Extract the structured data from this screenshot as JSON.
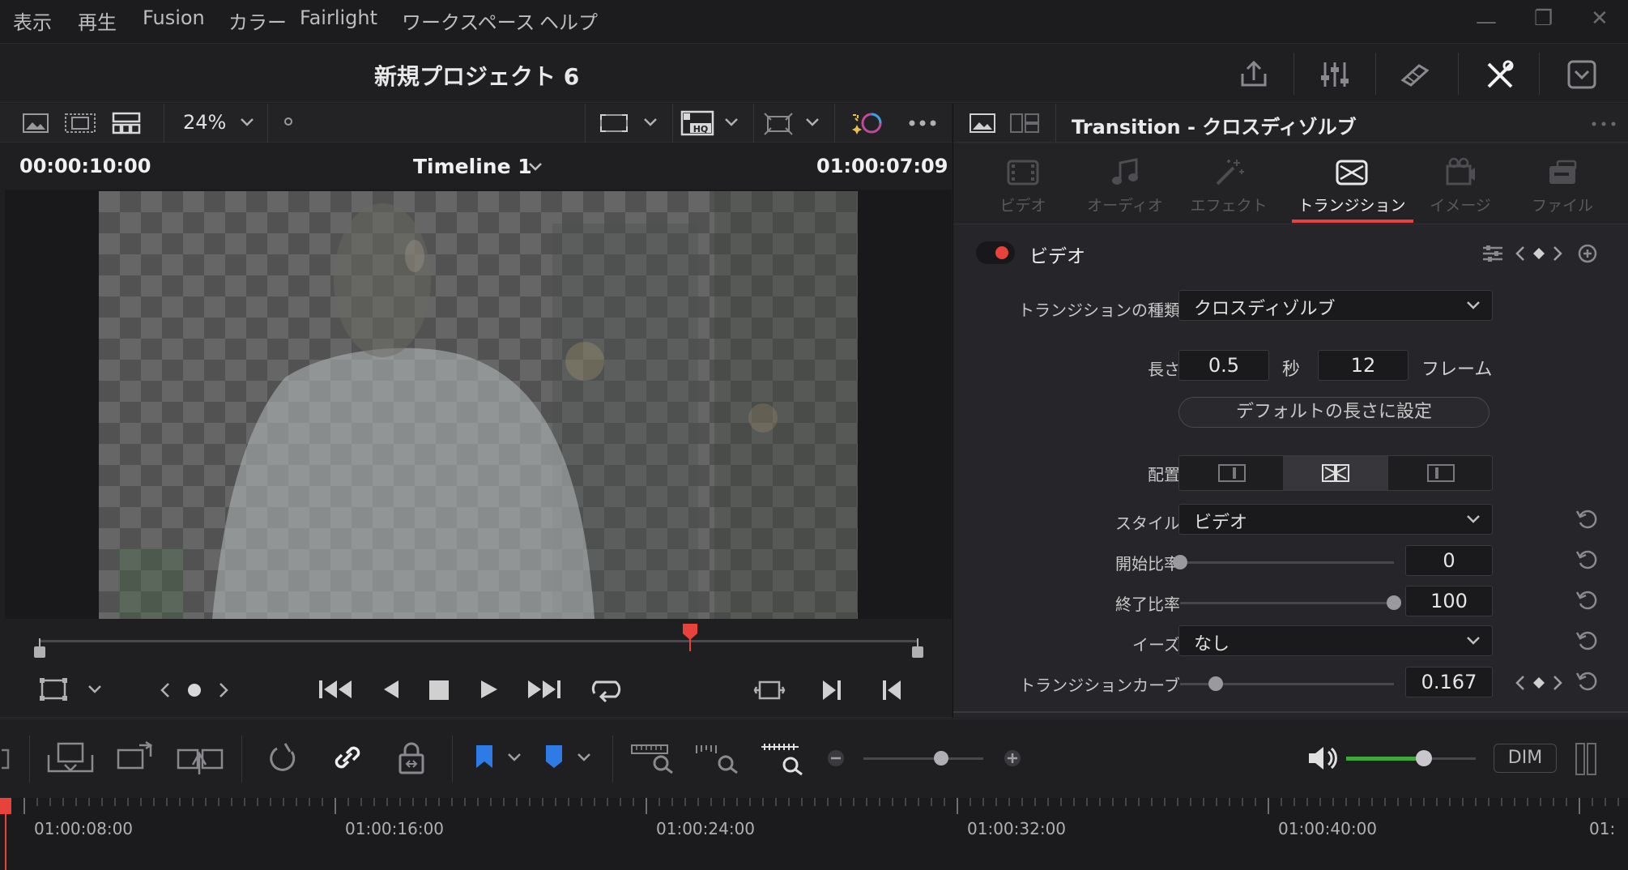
{
  "menu": {
    "items": [
      "表示",
      "再生",
      "Fusion",
      "カラー",
      "Fairlight",
      "ワークスペース",
      "ヘルプ"
    ]
  },
  "project": {
    "title": "新規プロジェクト 6"
  },
  "viewer": {
    "zoom": "24%",
    "source_timecode": "00:00:10:00",
    "timeline_name": "Timeline 1",
    "record_timecode": "01:00:07:09",
    "playhead_position": 0.74
  },
  "inspector": {
    "title": "Transition - クロスディゾルブ",
    "tabs": [
      {
        "label": "ビデオ",
        "active": false
      },
      {
        "label": "オーディオ",
        "active": false
      },
      {
        "label": "エフェクト",
        "active": false
      },
      {
        "label": "トランジション",
        "active": true
      },
      {
        "label": "イメージ",
        "active": false
      },
      {
        "label": "ファイル",
        "active": false
      }
    ],
    "section_title": "ビデオ",
    "transition_type_label": "トランジションの種類",
    "transition_type_value": "クロスディゾルブ",
    "duration_label": "長さ",
    "duration_seconds": "0.5",
    "seconds_unit": "秒",
    "duration_frames": "12",
    "frames_unit": "フレーム",
    "default_duration_button": "デフォルトの長さに設定",
    "alignment_label": "配置",
    "style_label": "スタイル",
    "style_value": "ビデオ",
    "start_ratio_label": "開始比率",
    "start_ratio_value": "0",
    "start_ratio_fraction": 0.0,
    "end_ratio_label": "終了比率",
    "end_ratio_value": "100",
    "end_ratio_fraction": 1.0,
    "ease_label": "イーズ",
    "ease_value": "なし",
    "curve_label": "トランジションカーブ",
    "curve_value": "0.167",
    "curve_fraction": 0.167
  },
  "bottom": {
    "dim_label": "DIM",
    "zoom_fraction": 0.65,
    "volume_fraction": 0.6
  },
  "ruler": {
    "timecodes": [
      "01:00:08:00",
      "01:00:16:00",
      "01:00:24:00",
      "01:00:32:00",
      "01:00:40:00",
      "01:"
    ]
  },
  "colors": {
    "accent_red": "#e8433a",
    "volume_green": "#3fa83a",
    "flag_blue": "#2f7be6"
  }
}
